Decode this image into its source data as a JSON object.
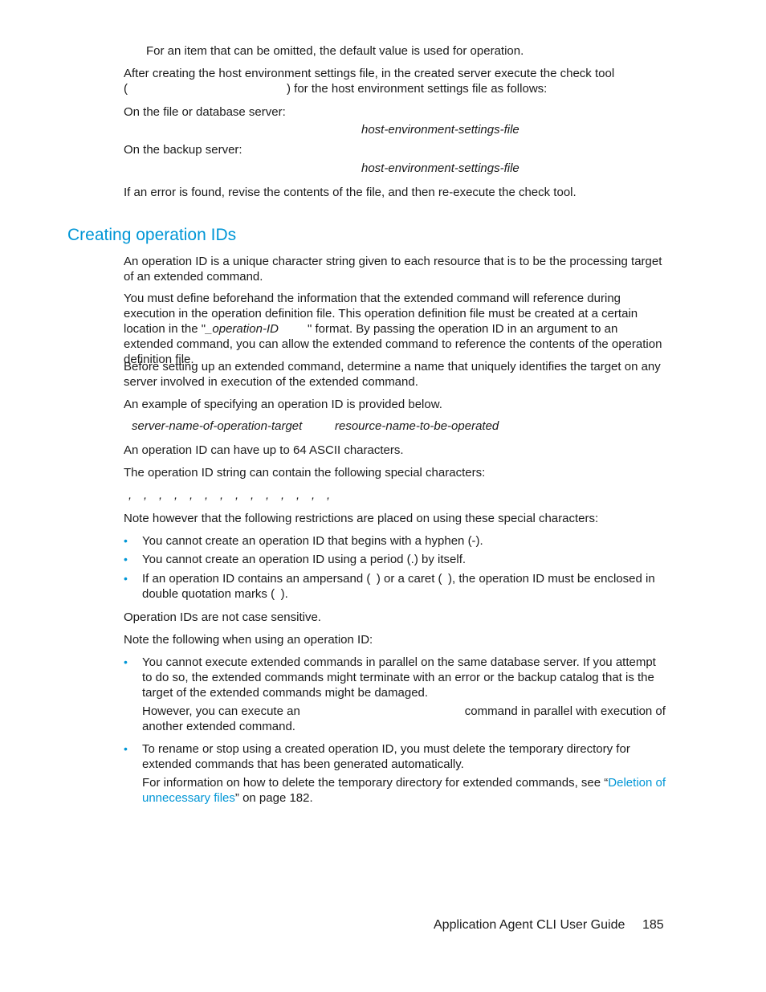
{
  "top": {
    "p0": "For an item that can be omitted, the default value is used for operation.",
    "p1_line1": "After creating the host environment settings file, in the created server execute the check tool",
    "p1_line2_open": "(",
    "p1_line2_rest": ") for the host environment settings file as follows:",
    "p2": "On the file or database server:",
    "p2_arg": "host-environment-settings-file",
    "p3": "On the backup server:",
    "p3_arg": "host-environment-settings-file",
    "p4": "If an error is found, revise the contents of the file, and then re-execute the check tool."
  },
  "section": {
    "title": "Creating operation IDs",
    "p1": "An operation ID is a unique character string given to each resource that is to be the processing target of an extended command.",
    "p2_a": "You must define beforehand the information that the extended command will reference during execution in the operation definition file. This operation definition file must be created at a certain location in the \"",
    "p2_italic": "_operation-ID",
    "p2_b": "\" format. By passing the operation ID in an argument to an extended command, you can allow the extended command to reference the contents of the operation definition file.",
    "p3": "Before setting up an extended command, determine a name that uniquely identifies the target on any server involved in execution of the extended command.",
    "p4": "An example of specifying an operation ID is provided below.",
    "example_a": "server-name-of-operation-target",
    "example_b": "resource-name-to-be-operated",
    "p5": "An operation ID can have up to 64 ASCII characters.",
    "p6": "The operation ID string can contain the following special characters:",
    "special_chars": [
      ",",
      ",",
      ",",
      ",",
      ",",
      ",",
      ",",
      ",",
      ",",
      ",",
      ",",
      ",",
      ",",
      ","
    ],
    "p7": "Note however that the following restrictions are placed on using these special characters:",
    "restrictions": [
      "You cannot create an operation ID that begins with a hyphen (-).",
      "You cannot create an operation ID using a period (.) by itself.",
      "If an operation ID contains an ampersand ( ) or a caret ( ), the operation ID must be enclosed in double quotation marks ( )."
    ],
    "p8": "Operation IDs are not case sensitive.",
    "p9": "Note the following when using an operation ID:",
    "notes": [
      {
        "text": "You cannot execute extended commands in parallel on the same database server. If you attempt to do so, the extended commands might terminate with an error or the backup catalog that is the target of the extended commands might be damaged.",
        "sub_a": "However, you can execute an",
        "sub_b": "command in parallel with execution of another extended command."
      },
      {
        "text": "To rename or stop using a created operation ID, you must delete the temporary directory for extended commands that has been generated automatically.",
        "sub_a": "For information on how to delete the temporary directory for extended commands, see “",
        "sub_link": "Deletion of unnecessary files",
        "sub_b": "” on page 182."
      }
    ]
  },
  "footer": {
    "title": "Application Agent CLI User Guide",
    "page": "185"
  },
  "colors": {
    "accent": "#0096d6",
    "text": "#1a1a1a"
  }
}
